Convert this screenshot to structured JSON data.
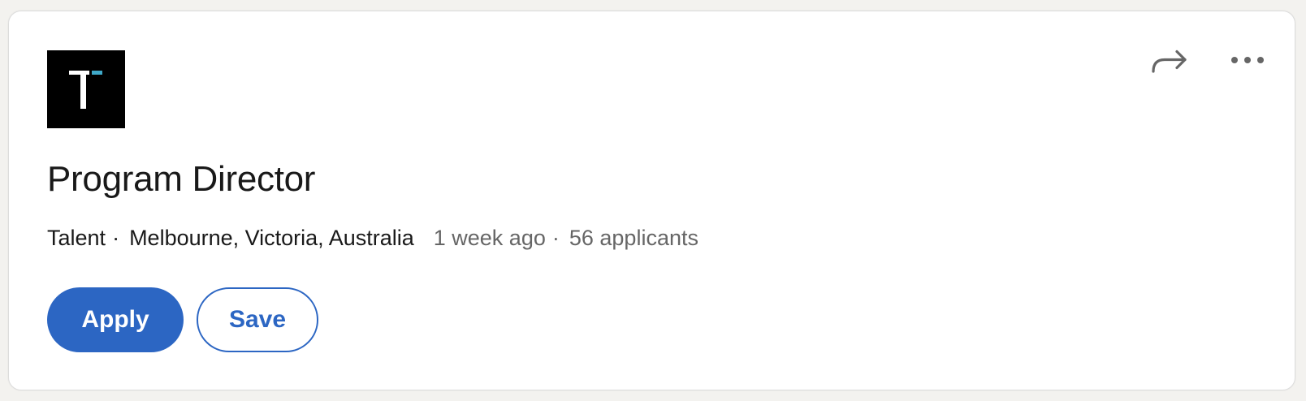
{
  "colors": {
    "accent": "#2c66c3",
    "text_primary": "#191919",
    "text_muted": "#666666",
    "logo_bg": "#000000",
    "logo_accent": "#3fa9c9"
  },
  "company": {
    "logo_icon": "talent-logo",
    "name": "Talent"
  },
  "header_actions": {
    "share_icon": "share-arrow-icon",
    "more_icon": "more-options-icon"
  },
  "job": {
    "title": "Program Director",
    "company": "Talent",
    "location": "Melbourne, Victoria, Australia",
    "posted": "1 week ago",
    "applicants": "56 applicants"
  },
  "actions": {
    "apply_label": "Apply",
    "save_label": "Save"
  }
}
